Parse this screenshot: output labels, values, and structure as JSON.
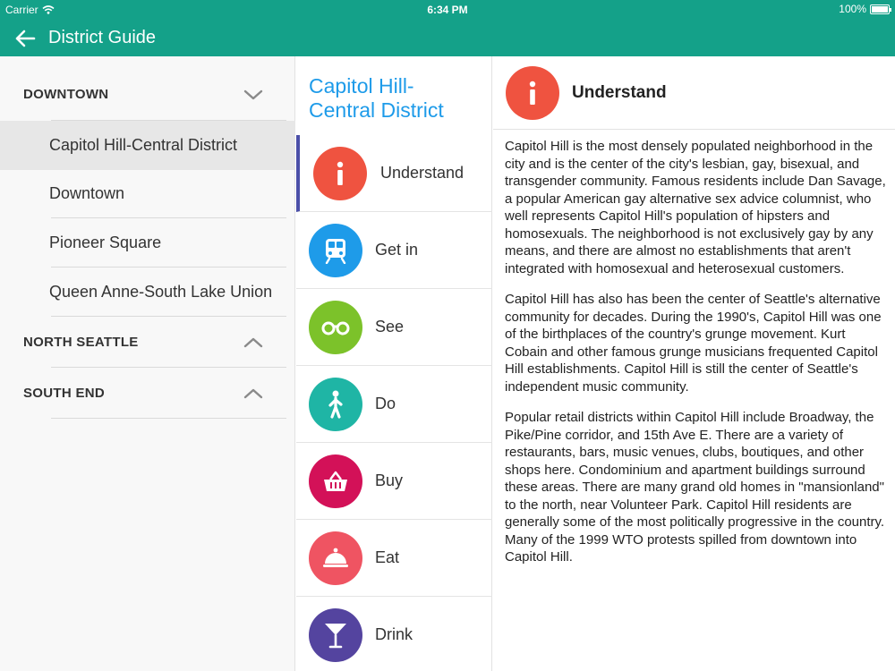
{
  "status_bar": {
    "carrier": "Carrier",
    "time": "6:34 PM",
    "battery": "100%"
  },
  "header": {
    "title": "District Guide",
    "back_icon": "arrow-left-icon",
    "color": "#14a189"
  },
  "districts_panel": {
    "sections": [
      {
        "label": "DOWNTOWN",
        "expanded": true,
        "chevron": "chevron-down-icon"
      },
      {
        "label": "NORTH SEATTLE",
        "expanded": false,
        "chevron": "chevron-up-icon"
      },
      {
        "label": "SOUTH END",
        "expanded": false,
        "chevron": "chevron-up-icon"
      }
    ],
    "downtown_items": [
      {
        "label": "Capitol Hill-Central District",
        "selected": true
      },
      {
        "label": "Downtown",
        "selected": false
      },
      {
        "label": "Pioneer Square",
        "selected": false
      },
      {
        "label": "Queen Anne-South Lake Union",
        "selected": false
      }
    ]
  },
  "topics_panel": {
    "title": "Capitol Hill-\nCentral District",
    "title_color": "#1e9be9",
    "active_indicator_color": "#4b4fa8",
    "items": [
      {
        "label": "Understand",
        "icon": "info-icon",
        "color": "#ef5340",
        "active": true
      },
      {
        "label": "Get in",
        "icon": "train-icon",
        "color": "#1e9be9",
        "active": false
      },
      {
        "label": "See",
        "icon": "binoculars-icon",
        "color": "#7cc22a",
        "active": false
      },
      {
        "label": "Do",
        "icon": "walking-person-icon",
        "color": "#1fb5a5",
        "active": false
      },
      {
        "label": "Buy",
        "icon": "basket-icon",
        "color": "#d31158",
        "active": false
      },
      {
        "label": "Eat",
        "icon": "cloche-icon",
        "color": "#ef5462",
        "active": false
      },
      {
        "label": "Drink",
        "icon": "cocktail-glass-icon",
        "color": "#54449f",
        "active": false
      }
    ]
  },
  "detail": {
    "title": "Understand",
    "icon": "info-icon",
    "icon_color": "#ef5340",
    "paragraphs": [
      "Capitol Hill is the most densely populated neighborhood in the city and is the center of the city's lesbian, gay, bisexual, and transgender community. Famous residents include Dan Savage, a popular American gay alternative sex advice columnist, who well represents Capitol Hill's population of hipsters and homosexuals. The neighborhood is not exclusively gay by any means, and there are almost no establishments that aren't integrated with homosexual and heterosexual customers.",
      "Capitol Hill has also has been the center of Seattle's alternative community for decades. During the 1990's, Capitol Hill was one of the birthplaces of the country's grunge movement. Kurt Cobain and other famous grunge musicians frequented Capitol Hill establishments. Capitol Hill is still the center of Seattle's independent music community.",
      "Popular retail districts within Capitol Hill include Broadway, the Pike/Pine corridor, and 15th Ave E. There are a variety of restaurants, bars, music venues, clubs, boutiques, and other shops here. Condominium and apartment buildings surround these areas. There are many grand old homes in \"mansionland\" to the north, near Volunteer Park. Capitol Hill residents are generally some of the most politically progressive in the country. Many of the 1999 WTO protests spilled from downtown into Capitol Hill."
    ]
  }
}
